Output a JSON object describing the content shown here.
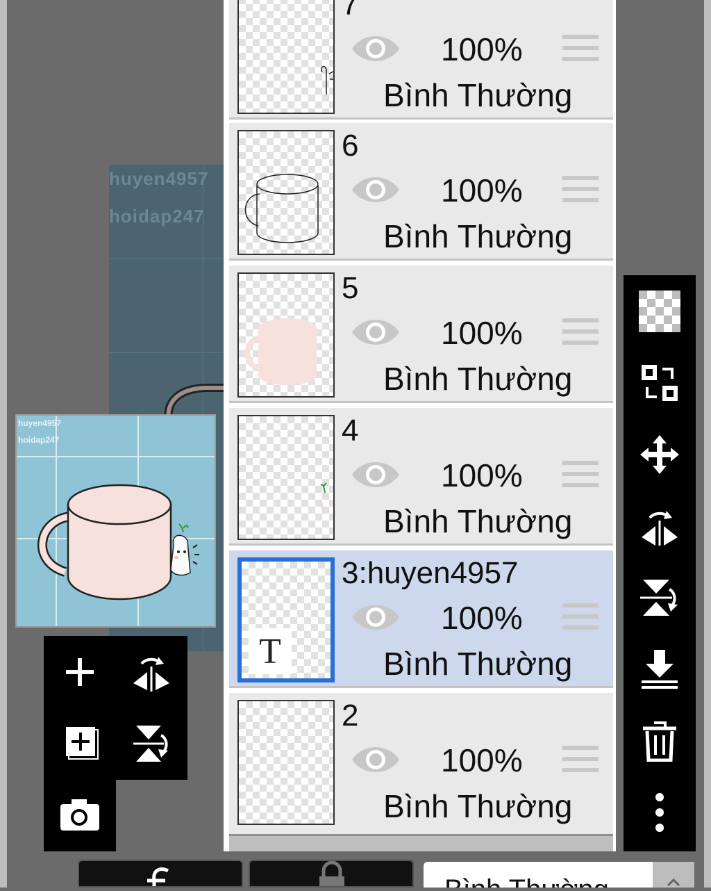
{
  "watermark": {
    "line1": "huyen4957",
    "line2": "hoidap247"
  },
  "layers": [
    {
      "name": "7",
      "opacity": "100%",
      "mode": "Bình Thường",
      "selected": false
    },
    {
      "name": "6",
      "opacity": "100%",
      "mode": "Bình Thường",
      "selected": false
    },
    {
      "name": "5",
      "opacity": "100%",
      "mode": "Bình Thường",
      "selected": false
    },
    {
      "name": "4",
      "opacity": "100%",
      "mode": "Bình Thường",
      "selected": false
    },
    {
      "name": "3:huyen4957",
      "opacity": "100%",
      "mode": "Bình Thường",
      "selected": true,
      "badge": "T"
    },
    {
      "name": "2",
      "opacity": "100%",
      "mode": "Bình Thường",
      "selected": false
    }
  ],
  "left_tools": [
    "add-layer-icon",
    "flip-horizontal-icon",
    "add-page-icon",
    "flip-vertical-icon",
    "camera-icon"
  ],
  "right_tools": [
    "transparency-icon",
    "swap-icon",
    "move-icon",
    "rotate-flip-horizontal-icon",
    "rotate-flip-vertical-icon",
    "merge-down-icon",
    "trash-icon",
    "more-icon"
  ],
  "bottom_bar": {
    "blend_mode": "Bình Thường"
  },
  "colors": {
    "background": "#6b6b6b",
    "selected_layer": "#cdd8ec",
    "selected_border": "#2b6fd6",
    "canvas_sky": "#8fc3d6",
    "cup_fill": "#f6e1dc"
  }
}
